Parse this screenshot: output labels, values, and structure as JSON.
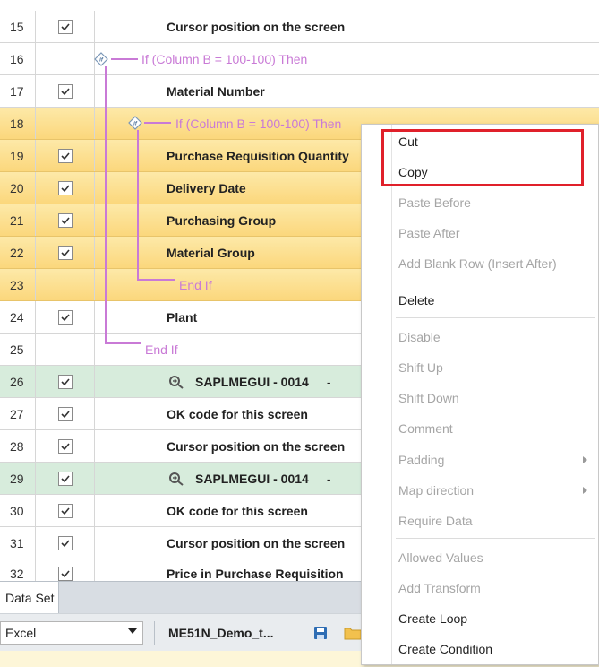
{
  "rows": [
    {
      "num": "15",
      "checked": true,
      "label": "Cursor position on the screen"
    },
    {
      "num": "16",
      "checked": false,
      "cond": "If (Column B = 100-100) Then"
    },
    {
      "num": "17",
      "checked": true,
      "label": "Material Number"
    },
    {
      "num": "18",
      "checked": false,
      "cond": "If (Column B = 100-100) Then"
    },
    {
      "num": "19",
      "checked": true,
      "label": "Purchase Requisition Quantity"
    },
    {
      "num": "20",
      "checked": true,
      "label": "Delivery Date"
    },
    {
      "num": "21",
      "checked": true,
      "label": "Purchasing Group"
    },
    {
      "num": "22",
      "checked": true,
      "label": "Material Group"
    },
    {
      "num": "23",
      "checked": false,
      "cond": "End If"
    },
    {
      "num": "24",
      "checked": true,
      "label": "Plant"
    },
    {
      "num": "25",
      "checked": false,
      "cond": "End If"
    },
    {
      "num": "26",
      "checked": true,
      "screen": "SAPLMEGUI - 0014",
      "dash": "-"
    },
    {
      "num": "27",
      "checked": true,
      "label": "OK code for this screen"
    },
    {
      "num": "28",
      "checked": true,
      "label": "Cursor position on the screen"
    },
    {
      "num": "29",
      "checked": true,
      "screen": "SAPLMEGUI - 0014",
      "dash": "-"
    },
    {
      "num": "30",
      "checked": true,
      "label": "OK code for this screen"
    },
    {
      "num": "31",
      "checked": true,
      "label": "Cursor position on the screen"
    },
    {
      "num": "32",
      "checked": true,
      "label": "Price in Purchase Requisition"
    }
  ],
  "diamond_text": "if",
  "tabs": {
    "data_set": "Data Set"
  },
  "toolbar": {
    "source": "Excel",
    "file_name": "ME51N_Demo_t..."
  },
  "context_menu": {
    "cut": "Cut",
    "copy": "Copy",
    "paste_before": "Paste Before",
    "paste_after": "Paste After",
    "add_blank_row": "Add Blank Row (Insert After)",
    "delete": "Delete",
    "disable": "Disable",
    "shift_up": "Shift Up",
    "shift_down": "Shift Down",
    "comment": "Comment",
    "padding": "Padding",
    "map_direction": "Map direction",
    "require_data": "Require Data",
    "allowed_values": "Allowed Values",
    "add_transform": "Add Transform",
    "create_loop": "Create Loop",
    "create_condition": "Create Condition"
  },
  "colors": {
    "selected_row": "#fbd77c",
    "screen_row": "#d7ecdc",
    "condition": "#c97ad6",
    "highlight_box": "#e0202a"
  }
}
